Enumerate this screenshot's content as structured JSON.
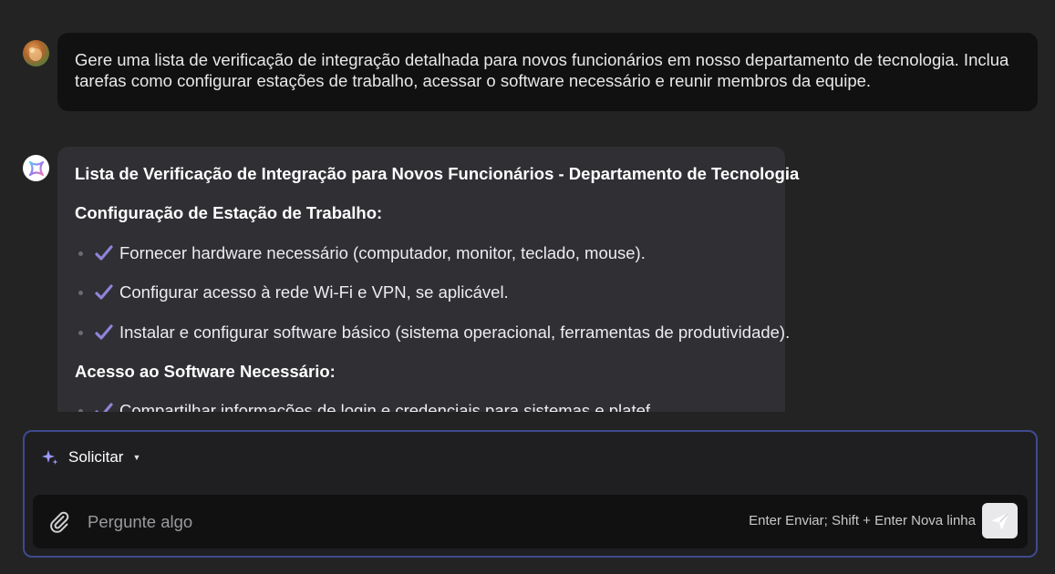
{
  "conversation": {
    "user_message": "Gere uma lista de verificação de integração detalhada para novos funcionários em nosso departamento de tecnologia. Inclua tarefas como configurar estações de trabalho, acessar o software necessário e reunir membros da equipe.",
    "bot": {
      "title": "Lista de Verificação de Integração para Novos Funcionários - Departamento de Tecnologia",
      "sections": [
        {
          "heading": "Configuração de Estação de Trabalho:",
          "items": [
            "Fornecer hardware necessário (computador, monitor, teclado, mouse).",
            "Configurar acesso à rede Wi-Fi e VPN, se aplicável.",
            "Instalar e configurar software básico (sistema operacional, ferramentas de produtividade)."
          ]
        },
        {
          "heading": "Acesso ao Software Necessário:",
          "items": [
            "Compartilhar informações de login e credenciais para sistemas e platef..."
          ]
        }
      ]
    }
  },
  "composer": {
    "mode_label": "Solicitar",
    "placeholder": "Pergunte algo",
    "hint": "Enter Enviar; Shift + Enter Nova linha"
  },
  "icons": {
    "user_avatar": "user-avatar-photo",
    "bot_avatar": "assistant-logo-icon",
    "check": "checkmark-icon",
    "sparkle": "sparkle-icon",
    "caret": "caret-down-icon",
    "attach": "paperclip-icon",
    "send": "send-icon"
  },
  "colors": {
    "background": "#232323",
    "user_bubble": "#111111",
    "bot_bubble": "#2f2f34",
    "check": "#8f84d8",
    "panel_border": "#3f4a8f"
  }
}
